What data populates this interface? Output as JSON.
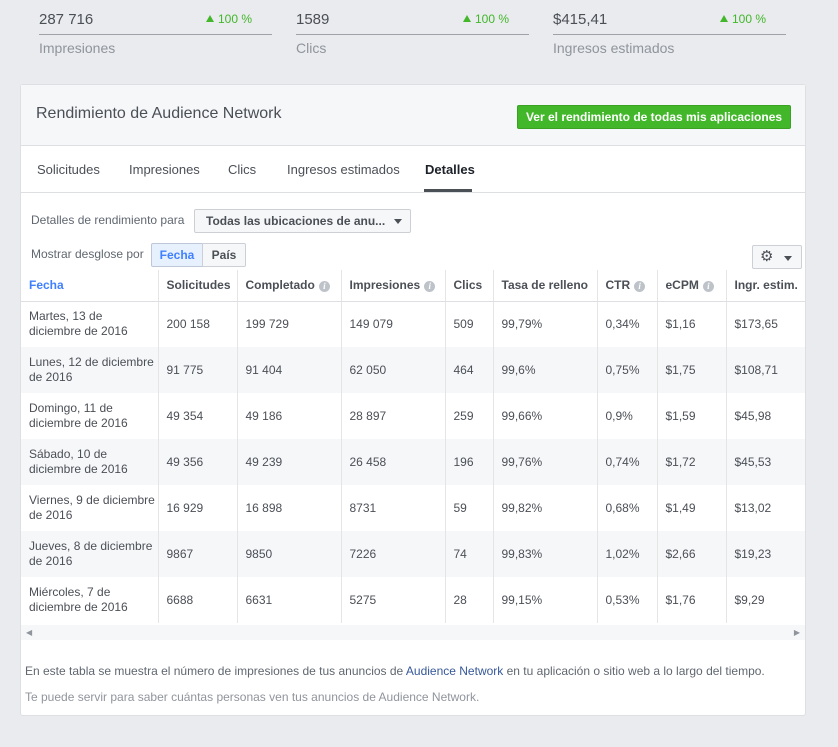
{
  "stats": [
    {
      "value": "287 716",
      "delta": "100 %",
      "label": "Impresiones"
    },
    {
      "value": "1589",
      "delta": "100 %",
      "label": "Clics"
    },
    {
      "value": "$415,41",
      "delta": "100 %",
      "label": "Ingresos estimados"
    }
  ],
  "card": {
    "title": "Rendimiento de Audience Network",
    "cta_label": "Ver el rendimiento de todas mis aplicaciones"
  },
  "tabs": [
    "Solicitudes",
    "Impresiones",
    "Clics",
    "Ingresos estimados",
    "Detalles"
  ],
  "active_tab": "Detalles",
  "filter": {
    "label": "Detalles de rendimiento para",
    "selected": "Todas las ubicaciones de anu..."
  },
  "breakdown": {
    "label": "Mostrar desglose por",
    "options": [
      "Fecha",
      "País"
    ],
    "selected": "Fecha"
  },
  "settings": {
    "icon": "gear-icon"
  },
  "table": {
    "columns": [
      "Fecha",
      "Solicitudes",
      "Completado",
      "Impresiones",
      "Clics",
      "Tasa de relleno",
      "CTR",
      "eCPM",
      "Ingr. estim."
    ],
    "rows": [
      [
        "Martes, 13 de diciembre de 2016",
        "200 158",
        "199 729",
        "149 079",
        "509",
        "99,79%",
        "0,34%",
        "$1,16",
        "$173,65"
      ],
      [
        "Lunes, 12 de diciembre de 2016",
        "91 775",
        "91 404",
        "62 050",
        "464",
        "99,6%",
        "0,75%",
        "$1,75",
        "$108,71"
      ],
      [
        "Domingo, 11 de diciembre de 2016",
        "49 354",
        "49 186",
        "28 897",
        "259",
        "99,66%",
        "0,9%",
        "$1,59",
        "$45,98"
      ],
      [
        "Sábado, 10 de diciembre de 2016",
        "49 356",
        "49 239",
        "26 458",
        "196",
        "99,76%",
        "0,74%",
        "$1,72",
        "$45,53"
      ],
      [
        "Viernes, 9 de diciembre de 2016",
        "16 929",
        "16 898",
        "8731",
        "59",
        "99,82%",
        "0,68%",
        "$1,49",
        "$13,02"
      ],
      [
        "Jueves, 8 de diciembre de 2016",
        "9867",
        "9850",
        "7226",
        "74",
        "99,83%",
        "1,02%",
        "$2,66",
        "$19,23"
      ],
      [
        "Miércoles, 7 de diciembre de 2016",
        "6688",
        "6631",
        "5275",
        "28",
        "99,15%",
        "0,53%",
        "$1,76",
        "$9,29"
      ]
    ]
  },
  "footer": {
    "line1_pre": "En este tabla se muestra el número de impresiones de tus anuncios de ",
    "line1_link": "Audience Network",
    "line1_post": " en tu aplicación o sitio web a lo largo del tiempo.",
    "line2": "Te puede servir para saber cuántas personas ven tus anuncios de Audience Network."
  },
  "colors": {
    "accent": "#4080ff",
    "success": "#42b72a",
    "link": "#365899"
  }
}
